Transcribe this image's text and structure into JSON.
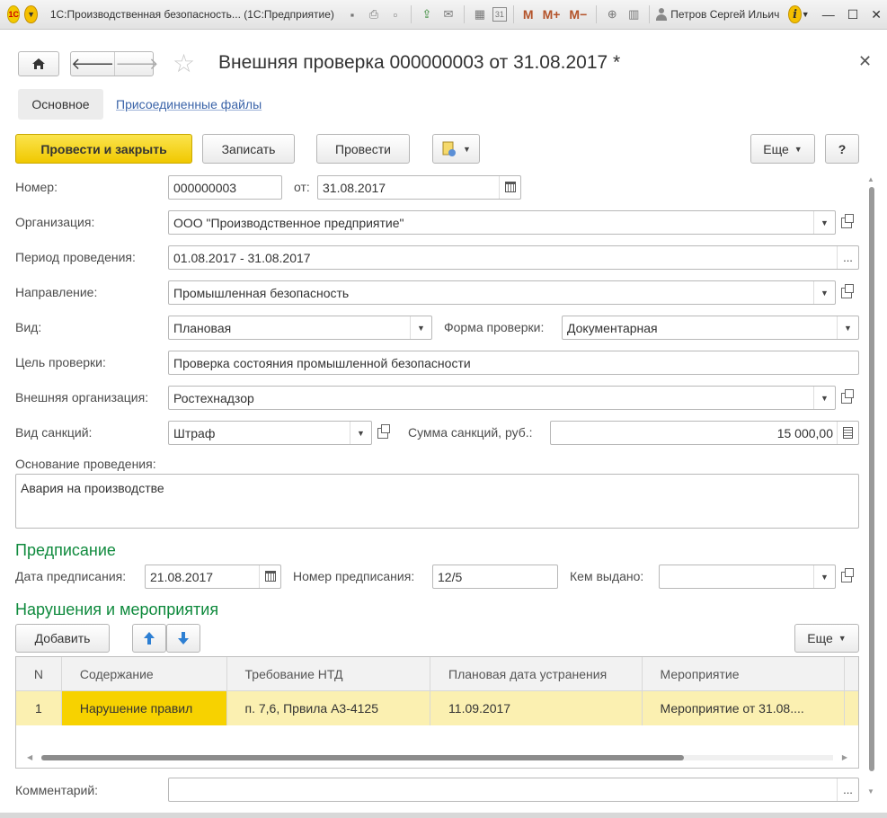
{
  "titlebar": {
    "logo": "1С",
    "title": "1С:Производственная безопасность... (1С:Предприятие)",
    "mem": [
      "M",
      "M+",
      "M−"
    ],
    "user": "Петров Сергей Ильич",
    "calendar_day": "31"
  },
  "header": {
    "title": "Внешняя проверка 000000003 от 31.08.2017 *"
  },
  "tabs": {
    "main": "Основное",
    "files": "Присоединенные файлы"
  },
  "toolbar": {
    "post_close": "Провести и закрыть",
    "save": "Записать",
    "post": "Провести",
    "more": "Еще",
    "help": "?"
  },
  "form": {
    "number_label": "Номер:",
    "number": "000000003",
    "date_label": "от:",
    "date": "31.08.2017",
    "org_label": "Организация:",
    "org": "ООО \"Производственное предприятие\"",
    "period_label": "Период проведения:",
    "period": "01.08.2017 - 31.08.2017",
    "direction_label": "Направление:",
    "direction": "Промышленная безопасность",
    "kind_label": "Вид:",
    "kind": "Плановая",
    "form_label": "Форма проверки:",
    "form_value": "Документарная",
    "goal_label": "Цель проверки:",
    "goal": "Проверка состояния промышленной безопасности",
    "ext_org_label": "Внешняя организация:",
    "ext_org": "Ростехнадзор",
    "sanction_label": "Вид санкций:",
    "sanction": "Штраф",
    "sum_label": "Сумма санкций, руб.:",
    "sum": "15 000,00",
    "basis_label": "Основание проведения:",
    "basis": "Авария на производстве",
    "dots": "..."
  },
  "prescription": {
    "title": "Предписание",
    "date_label": "Дата предписания:",
    "date": "21.08.2017",
    "number_label": "Номер предписания:",
    "number": "12/5",
    "issued_label": "Кем выдано:",
    "issued": ""
  },
  "violations": {
    "title": "Нарушения и мероприятия",
    "add": "Добавить",
    "more": "Еще",
    "columns": [
      "N",
      "Содержание",
      "Требование НТД",
      "Плановая дата устранения",
      "Мероприятие"
    ],
    "rows": [
      [
        "1",
        "Нарушение правил",
        "п. 7,6,  Првила А3-4125",
        "11.09.2017",
        "Мероприятие от 31.08...."
      ]
    ]
  },
  "comment": {
    "label": "Комментарий:",
    "value": ""
  }
}
